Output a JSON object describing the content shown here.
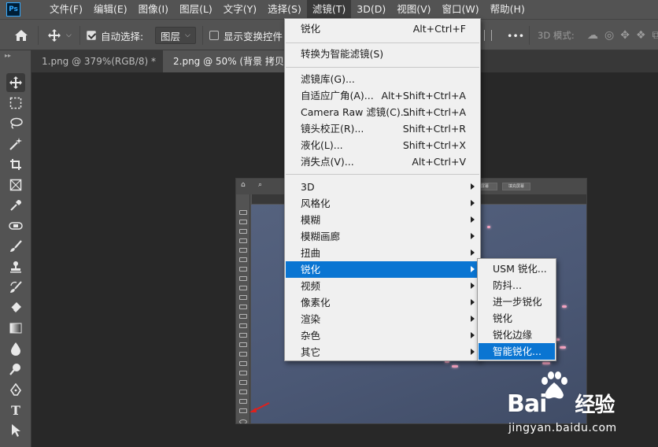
{
  "app": {
    "logo_text": "Ps"
  },
  "menubar": {
    "items": [
      {
        "label": "文件(F)"
      },
      {
        "label": "编辑(E)"
      },
      {
        "label": "图像(I)"
      },
      {
        "label": "图层(L)"
      },
      {
        "label": "文字(Y)"
      },
      {
        "label": "选择(S)"
      },
      {
        "label": "滤镜(T)",
        "active": true
      },
      {
        "label": "3D(D)"
      },
      {
        "label": "视图(V)"
      },
      {
        "label": "窗口(W)"
      },
      {
        "label": "帮助(H)"
      }
    ]
  },
  "options_bar": {
    "auto_select_label": "自动选择:",
    "auto_select_checked": true,
    "layer_dropdown_value": "图层",
    "show_transform_label": "显示变换控件",
    "show_transform_checked": false,
    "more_label": "•••",
    "mode_3d_label": "3D 模式:"
  },
  "tabs": [
    {
      "label": "1.png @ 379%(RGB/8) *",
      "close": "×",
      "active": false
    },
    {
      "label": "2.png @ 50% (背景 拷贝,",
      "close": "",
      "active": true
    }
  ],
  "filter_menu": {
    "items": [
      {
        "label": "锐化",
        "shortcut": "Alt+Ctrl+F"
      },
      {
        "label": "转换为智能滤镜(S)",
        "shortcut": ""
      },
      {
        "label": "滤镜库(G)...",
        "shortcut": ""
      },
      {
        "label": "自适应广角(A)...",
        "shortcut": "Alt+Shift+Ctrl+A"
      },
      {
        "label": "Camera Raw 滤镜(C)...",
        "shortcut": "Shift+Ctrl+A"
      },
      {
        "label": "镜头校正(R)...",
        "shortcut": "Shift+Ctrl+R"
      },
      {
        "label": "液化(L)...",
        "shortcut": "Shift+Ctrl+X"
      },
      {
        "label": "消失点(V)...",
        "shortcut": "Alt+Ctrl+V"
      },
      {
        "label": "3D",
        "submenu": true
      },
      {
        "label": "风格化",
        "submenu": true
      },
      {
        "label": "模糊",
        "submenu": true
      },
      {
        "label": "模糊画廊",
        "submenu": true
      },
      {
        "label": "扭曲",
        "submenu": true
      },
      {
        "label": "锐化",
        "submenu": true,
        "highlighted": true
      },
      {
        "label": "视频",
        "submenu": true
      },
      {
        "label": "像素化",
        "submenu": true
      },
      {
        "label": "渲染",
        "submenu": true
      },
      {
        "label": "杂色",
        "submenu": true
      },
      {
        "label": "其它",
        "submenu": true
      }
    ]
  },
  "sharpen_submenu": {
    "items": [
      {
        "label": "USM 锐化..."
      },
      {
        "label": "防抖..."
      },
      {
        "label": "进一步锐化"
      },
      {
        "label": "锐化"
      },
      {
        "label": "锐化边缘"
      },
      {
        "label": "智能锐化...",
        "highlighted": true
      }
    ]
  },
  "embedded_screenshot": {
    "buttons": [
      "屏幕",
      "填充屏幕"
    ]
  },
  "watermark": {
    "logo_text": "Bai",
    "logo_suffix": "经验",
    "url": "jingyan.baidu.com"
  },
  "tools": [
    "move-tool-icon",
    "marquee-tool-icon",
    "lasso-tool-icon",
    "magic-wand-tool-icon",
    "crop-tool-icon",
    "frame-tool-icon",
    "eyedropper-tool-icon",
    "healing-brush-tool-icon",
    "brush-tool-icon",
    "clone-stamp-tool-icon",
    "history-brush-tool-icon",
    "eraser-tool-icon",
    "gradient-tool-icon",
    "blur-tool-icon",
    "dodge-tool-icon",
    "pen-tool-icon",
    "type-tool-icon",
    "path-selection-tool-icon"
  ],
  "colors": {
    "highlight": "#0a75d2",
    "ps_blue": "#31a8ff",
    "ui_gray": "#535353"
  }
}
